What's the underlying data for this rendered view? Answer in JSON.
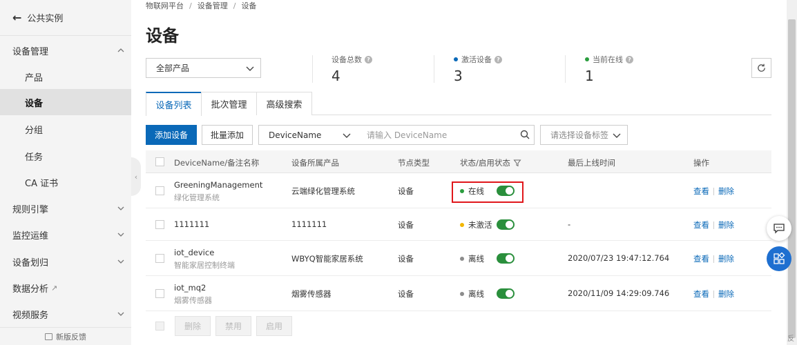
{
  "sidebar": {
    "back_label": "公共实例",
    "groups": [
      {
        "label": "设备管理"
      },
      {
        "label": "产品"
      },
      {
        "label": "设备"
      },
      {
        "label": "分组"
      },
      {
        "label": "任务"
      },
      {
        "label": "CA 证书"
      },
      {
        "label": "规则引擎"
      },
      {
        "label": "监控运维"
      },
      {
        "label": "设备划归"
      },
      {
        "label": "数据分析"
      },
      {
        "label": "视频服务"
      }
    ],
    "feedback_label": "新版反馈"
  },
  "breadcrumb": [
    "物联网平台",
    "设备管理",
    "设备"
  ],
  "page_title": "设备",
  "product_select": {
    "value": "全部产品"
  },
  "stats": {
    "total": {
      "label": "设备总数",
      "value": "4"
    },
    "activated": {
      "label": "激活设备",
      "value": "3"
    },
    "online": {
      "label": "当前在线",
      "value": "1"
    }
  },
  "tabs": [
    {
      "label": "设备列表"
    },
    {
      "label": "批次管理"
    },
    {
      "label": "高级搜索"
    }
  ],
  "toolbar": {
    "add_label": "添加设备",
    "batch_add_label": "批量添加",
    "field_select_value": "DeviceName",
    "search_placeholder": "请输入 DeviceName",
    "tag_placeholder": "请选择设备标签"
  },
  "table": {
    "headers": [
      "DeviceName/备注名称",
      "设备所属产品",
      "节点类型",
      "状态/启用状态",
      "最后上线时间",
      "操作"
    ],
    "rows": [
      {
        "name": "GreeningManagement",
        "note": "绿化管理系统",
        "product": "云端绿化管理系统",
        "node_type": "设备",
        "status": "在线",
        "status_color": "#2a9d3e",
        "last_online": "",
        "view": "查看",
        "delete": "删除"
      },
      {
        "name": "1111111",
        "note": "",
        "product": "1111111",
        "node_type": "设备",
        "status": "未激活",
        "status_color": "#f2b600",
        "last_online": "-",
        "view": "查看",
        "delete": "删除"
      },
      {
        "name": "iot_device",
        "note": "智能家居控制终端",
        "product": "WBYQ智能家居系统",
        "node_type": "设备",
        "status": "离线",
        "status_color": "#8c8c8c",
        "last_online": "2020/07/23 19:47:12.764",
        "view": "查看",
        "delete": "删除"
      },
      {
        "name": "iot_mq2",
        "note": "烟雾传感器",
        "product": "烟雾传感器",
        "node_type": "设备",
        "status": "离线",
        "status_color": "#8c8c8c",
        "last_online": "2020/11/09 14:29:09.746",
        "view": "查看",
        "delete": "删除"
      }
    ]
  },
  "footer_buttons": {
    "delete": "删除",
    "disable": "禁用",
    "enable": "启用"
  },
  "corner_text": "反",
  "colors": {
    "primary": "#0a69b8",
    "online": "#2a9d3e",
    "highlight": "#e0161a"
  }
}
